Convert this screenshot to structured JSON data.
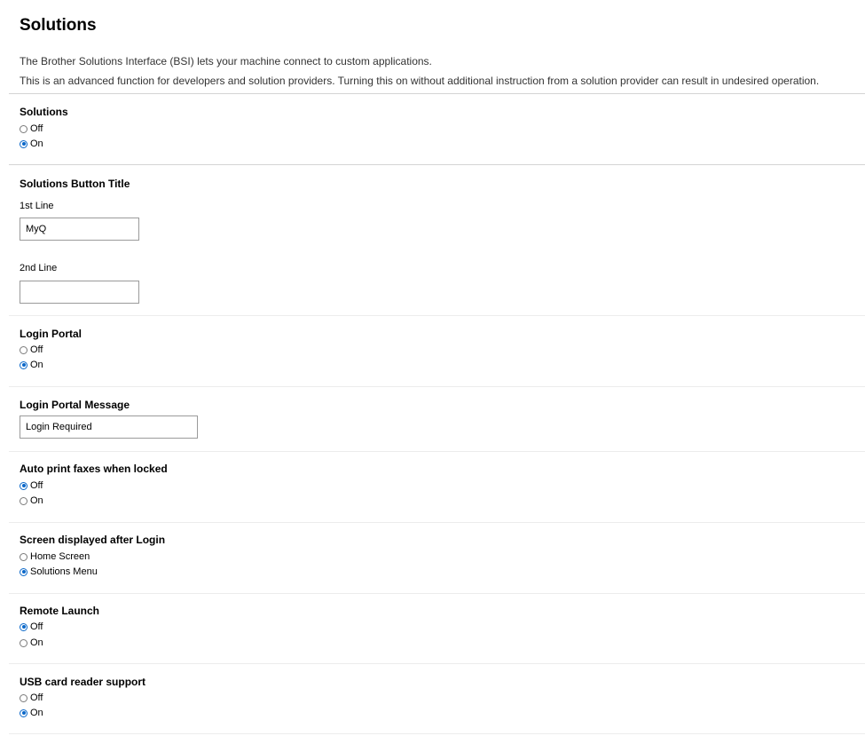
{
  "page": {
    "title": "Solutions",
    "intro_lines": [
      "The Brother Solutions Interface (BSI) lets your machine connect to custom applications.",
      "This is an advanced function for developers and solution providers. Turning this on without additional instruction from a solution provider can result in undesired operation."
    ]
  },
  "sections": {
    "solutions": {
      "title": "Solutions",
      "options": [
        {
          "label": "Off",
          "checked": false
        },
        {
          "label": "On",
          "checked": true
        }
      ]
    },
    "button_title": {
      "title": "Solutions Button Title",
      "line1_label": "1st Line",
      "line1_value": "MyQ",
      "line2_label": "2nd Line",
      "line2_value": ""
    },
    "login_portal": {
      "title": "Login Portal",
      "options": [
        {
          "label": "Off",
          "checked": false
        },
        {
          "label": "On",
          "checked": true
        }
      ]
    },
    "login_message": {
      "title": "Login Portal Message",
      "value": "Login Required"
    },
    "auto_print": {
      "title": "Auto print faxes when locked",
      "options": [
        {
          "label": "Off",
          "checked": true
        },
        {
          "label": "On",
          "checked": false
        }
      ]
    },
    "screen_after_login": {
      "title": "Screen displayed after Login",
      "options": [
        {
          "label": "Home Screen",
          "checked": false
        },
        {
          "label": "Solutions Menu",
          "checked": true
        }
      ]
    },
    "remote_launch": {
      "title": "Remote Launch",
      "options": [
        {
          "label": "Off",
          "checked": true
        },
        {
          "label": "On",
          "checked": false
        }
      ]
    },
    "usb_card_reader": {
      "title": "USB card reader support",
      "options": [
        {
          "label": "Off",
          "checked": false
        },
        {
          "label": "On",
          "checked": true
        }
      ]
    }
  },
  "colors": {
    "accent": "#0b68c9",
    "divider": "#d4d4d4"
  }
}
